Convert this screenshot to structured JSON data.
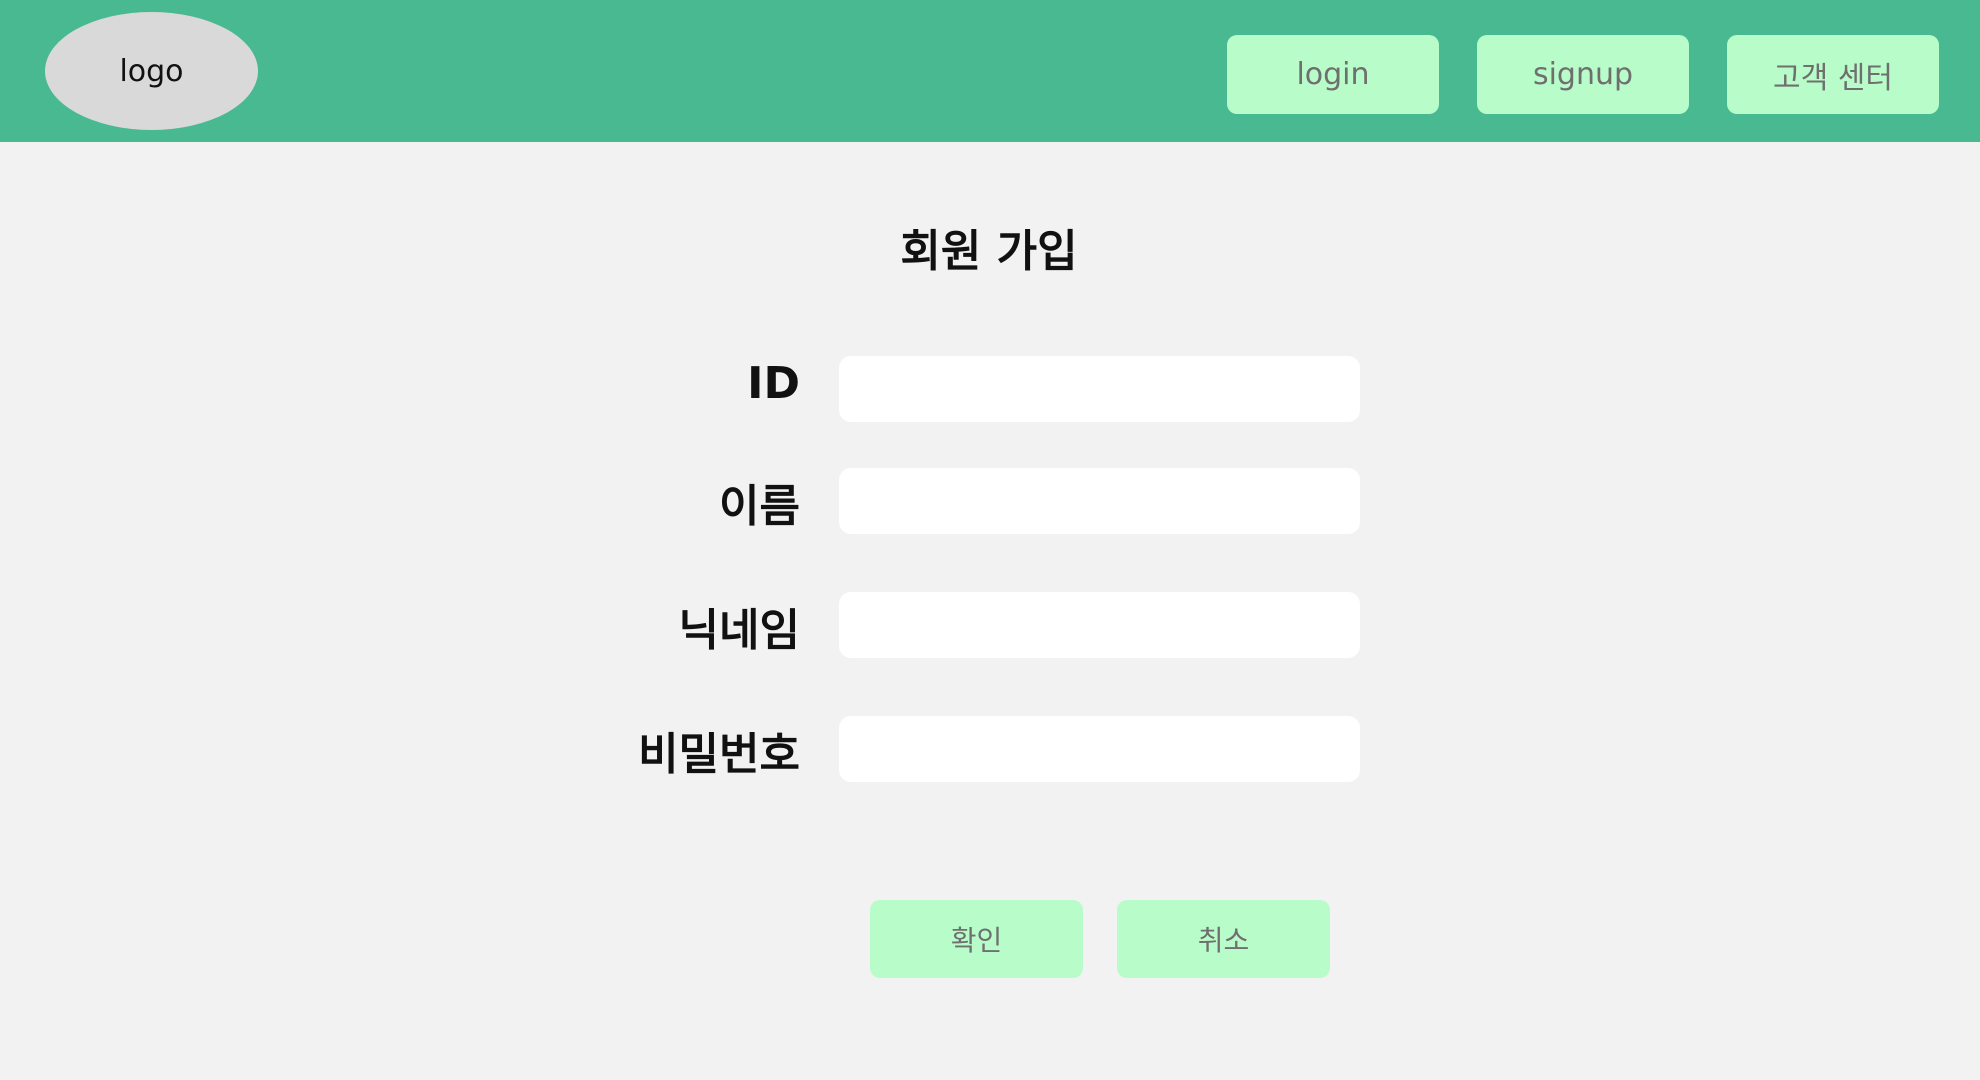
{
  "header": {
    "logo_text": "logo",
    "nav": {
      "login": "login",
      "signup": "signup",
      "support": "고객 센터"
    }
  },
  "form": {
    "title": "회원 가입",
    "fields": {
      "id": {
        "label": "ID",
        "value": "",
        "placeholder": ""
      },
      "name": {
        "label": "이름",
        "value": "",
        "placeholder": ""
      },
      "nickname": {
        "label": "닉네임",
        "value": "",
        "placeholder": ""
      },
      "password": {
        "label": "비밀번호",
        "value": "",
        "placeholder": ""
      }
    },
    "buttons": {
      "confirm": "확인",
      "cancel": "취소"
    }
  },
  "colors": {
    "header_bg": "#48b990",
    "page_bg": "#f2f2f2",
    "button_bg": "#b8fdc9",
    "button_text": "#6f6f6f",
    "logo_bg": "#d9d9d9",
    "input_bg": "#ffffff"
  }
}
